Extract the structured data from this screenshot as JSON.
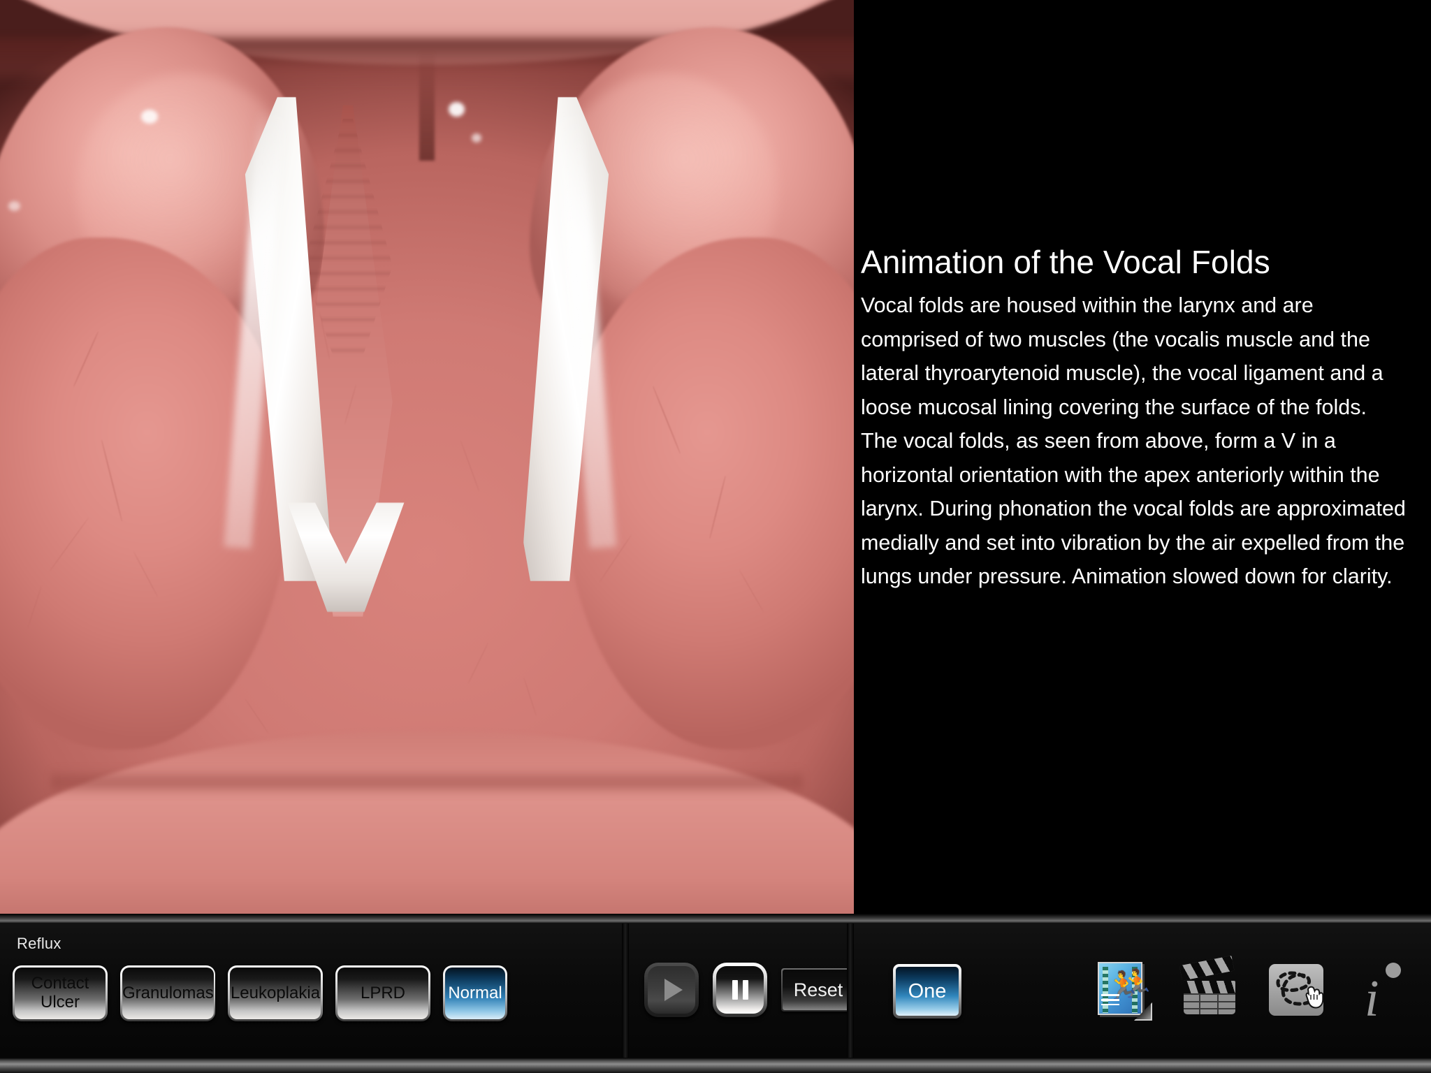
{
  "app": {
    "panel_title": "Animation of the Vocal Folds",
    "body_text": "Vocal folds are housed within the larynx and are comprised of two muscles (the vocalis muscle and the lateral thyroarytenoid muscle), the vocal ligament and a loose mucosal lining covering the surface of the folds. The vocal folds, as seen from above, form a V in a horizontal orientation with the apex anteriorly within the larynx. During phonation the vocal folds are approximated medially and set into vibration by the air expelled from the lungs under pressure. Animation slowed down for clarity."
  },
  "viewer": {
    "illustration_name": "vocal-folds-superior-view"
  },
  "toolbar": {
    "conditions": {
      "group_label": "Reflux",
      "buttons": [
        {
          "label": "Contact\nUlcer",
          "name": "condition-contact-ulcer",
          "selected": false
        },
        {
          "label": "Granulomas",
          "name": "condition-granulomas",
          "selected": false
        },
        {
          "label": "Leukoplakia",
          "name": "condition-leukoplakia",
          "selected": false
        },
        {
          "label": "LPRD",
          "name": "condition-lprd",
          "selected": false
        },
        {
          "label": "Normal",
          "name": "condition-normal",
          "selected": true
        }
      ]
    },
    "playback": {
      "play_label": "play-icon",
      "pause_label": "pause-icon",
      "reset_label": "Reset",
      "play_enabled": false,
      "pause_active": true
    },
    "tools": {
      "view_count_label": "One",
      "view_count_selected": true,
      "icons": [
        {
          "name": "animation-icon",
          "label": "Animation"
        },
        {
          "name": "movie-clapperboard-icon",
          "label": "Movie"
        },
        {
          "name": "draw-lasso-icon",
          "label": "Draw"
        },
        {
          "name": "info-icon",
          "label": "Info"
        }
      ]
    }
  },
  "colors": {
    "background": "#000000",
    "accent_blue": "#3187bd",
    "text": "#ffffff",
    "tissue_pink": "#d98a84",
    "fold_white": "#ffffff"
  }
}
